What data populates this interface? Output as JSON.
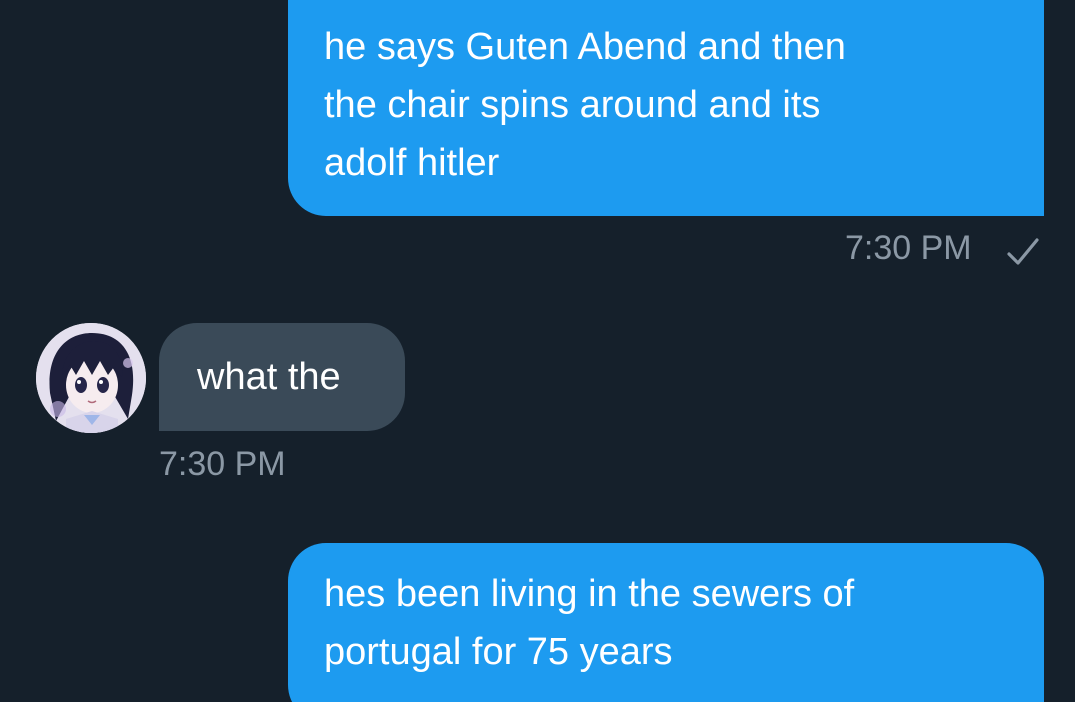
{
  "messages": [
    {
      "direction": "outgoing",
      "lines": [
        "he says Guten Abend and then",
        "the chair spins around and its",
        "adolf hitler"
      ],
      "time": "7:30 PM",
      "status_icon": "check-icon"
    },
    {
      "direction": "incoming",
      "text": "what the",
      "time": "7:30 PM",
      "avatar_icon": "anime-girl-avatar"
    },
    {
      "direction": "outgoing",
      "lines": [
        "hes been living in the sewers of",
        "portugal for 75 years"
      ]
    }
  ],
  "colors": {
    "background": "#15202b",
    "outgoing_bubble": "#1d9bf0",
    "incoming_bubble": "#3a4a58",
    "timestamp": "#8b98a5",
    "text": "#ffffff"
  }
}
